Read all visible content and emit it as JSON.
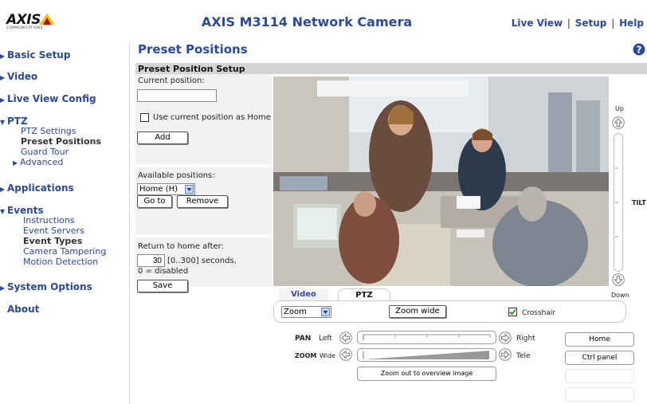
{
  "header": {
    "logo_text": "AXIS",
    "logo_sub": "COMMUNICATIONS",
    "title": "AXIS M3114 Network Camera",
    "links": {
      "live_view": "Live View",
      "setup": "Setup",
      "help": "Help",
      "sep": "|"
    }
  },
  "sidebar": {
    "basic_setup": "Basic Setup",
    "video": "Video",
    "live_view_config": "Live View Config",
    "ptz": "PTZ",
    "ptz_settings": "PTZ Settings",
    "preset_positions": "Preset Positions",
    "guard_tour": "Guard Tour",
    "advanced": "Advanced",
    "applications": "Applications",
    "events": "Events",
    "instructions": "Instructions",
    "event_servers": "Event Servers",
    "event_types": "Event Types",
    "camera_tampering": "Camera Tampering",
    "motion_detection": "Motion Detection",
    "system_options": "System Options",
    "about": "About"
  },
  "main": {
    "page_title": "Preset Positions",
    "section_title": "Preset Position Setup",
    "current_position_label": "Current position:",
    "current_position_value": "",
    "use_home_label": "Use current position as Home",
    "use_home_checked": false,
    "add_button": "Add",
    "available_label": "Available positions:",
    "available_selected": "Home (H)",
    "goto_button": "Go to",
    "remove_button": "Remove",
    "return_label": "Return to home after:",
    "return_value": "30",
    "return_hint": "[0..300] seconds,",
    "return_hint2": "0 = disabled",
    "save_button": "Save"
  },
  "camera": {
    "tilt_up": "Up",
    "tilt_down": "Down",
    "tilt_label": "TILT",
    "tab_video": "Video",
    "tab_ptz": "PTZ",
    "zoom_select": "Zoom",
    "zoom_wide_button": "Zoom wide",
    "crosshair_label": "Crosshair",
    "crosshair_checked": true,
    "pan_label": "PAN",
    "pan_left": "Left",
    "pan_right": "Right",
    "zoom_label": "ZOOM",
    "zoom_wide": "Wide",
    "zoom_tele": "Tele",
    "zoom_out_button": "Zoom out to overview image",
    "home_button": "Home",
    "ctrl_panel_button": "Ctrl panel"
  },
  "colors": {
    "brand_blue": "#2c4a9a",
    "section_bar": "#d4d4d4",
    "panel_bg": "#f2f2f2",
    "logo_yellow": "#f5c400"
  },
  "icons": [
    "help-icon",
    "arrow-up-icon",
    "arrow-down-icon",
    "arrow-left-icon",
    "arrow-right-icon",
    "checkbox-check-icon",
    "dropdown-arrow-icon"
  ]
}
